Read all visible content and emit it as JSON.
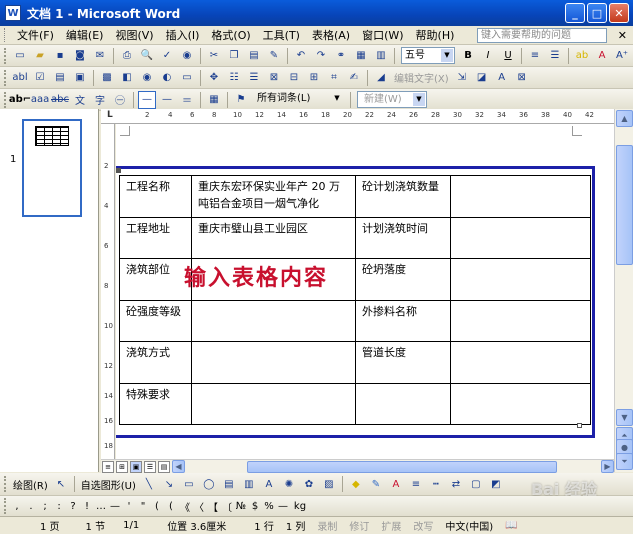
{
  "window": {
    "title": "文档 1 - Microsoft Word",
    "app_icon": "W"
  },
  "menu": {
    "items": [
      "文件(F)",
      "编辑(E)",
      "视图(V)",
      "插入(I)",
      "格式(O)",
      "工具(T)",
      "表格(A)",
      "窗口(W)",
      "帮助(H)"
    ],
    "help_placeholder": "键入需要帮助的问题"
  },
  "toolbar_standard": {
    "font_size": "五号",
    "bold": "B",
    "italic": "I",
    "underline": "U"
  },
  "toolbar_forms": {
    "text_label": "编辑文字(X)"
  },
  "toolbar_styles": {
    "all_entries": "所有词条(L)",
    "new_label": "新建(W)"
  },
  "ruler": {
    "h_ticks": [
      "2",
      "4",
      "6",
      "8",
      "10",
      "12",
      "14",
      "16",
      "18",
      "20",
      "22",
      "24",
      "26",
      "28",
      "30",
      "32",
      "34",
      "36",
      "38",
      "40",
      "42"
    ],
    "v_ticks": [
      "2",
      "4",
      "6",
      "8",
      "10",
      "12",
      "14",
      "16",
      "18"
    ]
  },
  "thumbnail": {
    "page_number": "1"
  },
  "table": {
    "rows": [
      [
        "工程名称",
        "重庆东宏环保实业年产 20 万吨铝合金项目一烟气净化",
        "砼计划浇筑数量",
        ""
      ],
      [
        "工程地址",
        "重庆市璧山县工业园区",
        "计划浇筑时间",
        ""
      ],
      [
        "浇筑部位",
        "",
        "砼坍落度",
        ""
      ],
      [
        "砼强度等级",
        "",
        "外掺料名称",
        ""
      ],
      [
        "浇筑方式",
        "",
        "管道长度",
        ""
      ],
      [
        "特殊要求",
        "",
        "",
        ""
      ]
    ]
  },
  "overlay_text": "输入表格内容",
  "drawing": {
    "draw_label": "绘图(R)",
    "autoshapes_label": "自选图形(U)"
  },
  "symbols": [
    ",",
    ".",
    ";",
    ":",
    "?",
    "!",
    "…",
    "—",
    "'",
    "\"",
    "(",
    "(",
    "《",
    "〈",
    "【",
    "〔",
    "№",
    "$",
    "%",
    "—",
    "kg"
  ],
  "status": {
    "page": "1 页",
    "section": "1 节",
    "page_of": "1/1",
    "position": "位置 3.6厘米",
    "line": "1 行",
    "column": "1 列",
    "rec": "录制",
    "trk": "修订",
    "ext": "扩展",
    "ovr": "改写",
    "language": "中文(中国)"
  },
  "watermark": "Bai 经验"
}
